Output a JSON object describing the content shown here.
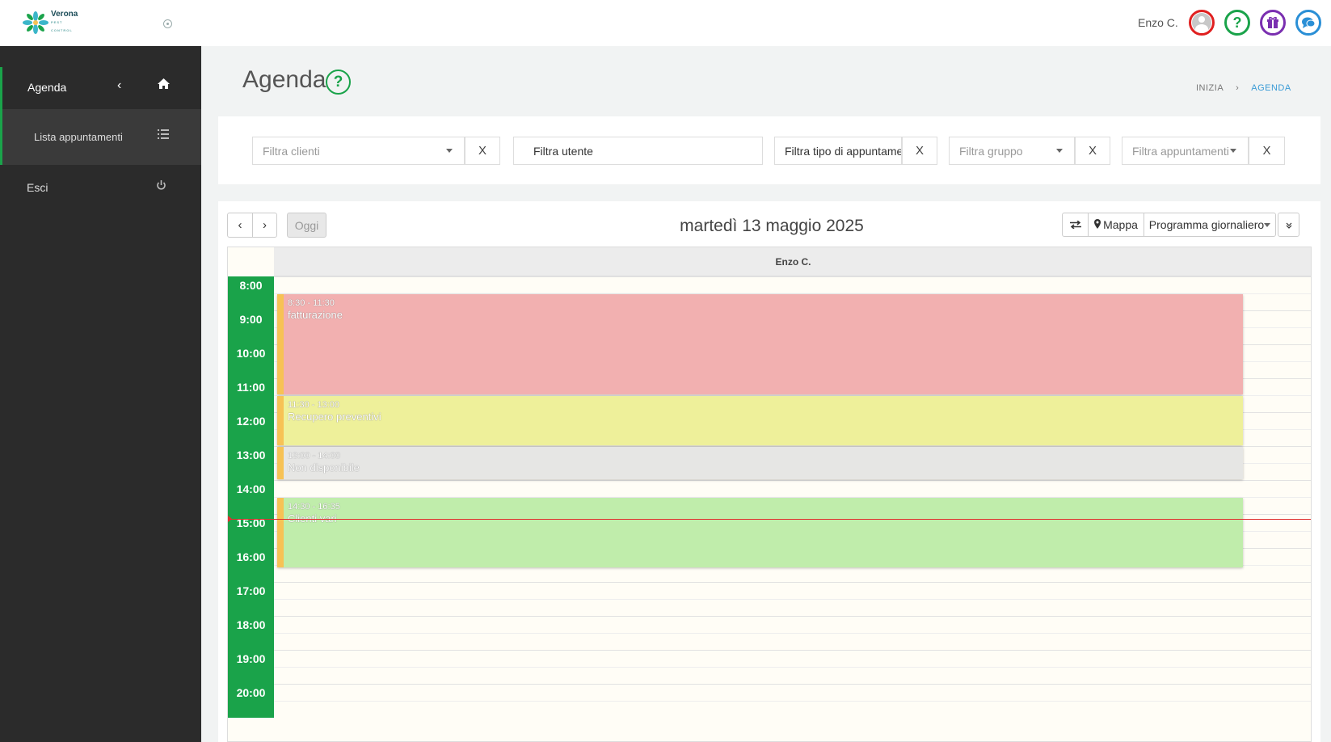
{
  "header": {
    "logo_name": "Verona",
    "logo_tagline": "PEST CONTROL",
    "user_name": "Enzo C.",
    "icons": [
      "user-avatar-icon",
      "help-icon",
      "gift-icon",
      "chat-icon"
    ]
  },
  "sidebar": {
    "items": [
      {
        "label": "Agenda",
        "icon": "home-icon"
      },
      {
        "label": "Lista appuntamenti",
        "icon": "list-icon"
      },
      {
        "label": "Esci",
        "icon": "power-icon"
      }
    ]
  },
  "page": {
    "title": "Agenda",
    "breadcrumb": {
      "home": "INIZIA",
      "current": "AGENDA"
    }
  },
  "filters": {
    "clienti_placeholder": "Filtra clienti",
    "utente_value": "Filtra utente",
    "tipo_value": "Filtra tipo di appuntamento",
    "gruppo_placeholder": "Filtra gruppo",
    "appuntamenti_placeholder": "Filtra appuntamenti",
    "clear_label": "X"
  },
  "calendar": {
    "today_label": "Oggi",
    "date_title": "martedì 13 maggio 2025",
    "map_label": "Mappa",
    "view_label": "Programma giornaliero",
    "resource": "Enzo C.",
    "hours": [
      "8:00",
      "9:00",
      "10:00",
      "11:00",
      "12:00",
      "13:00",
      "14:00",
      "15:00",
      "16:00",
      "17:00",
      "18:00",
      "19:00",
      "20:00"
    ],
    "events": [
      {
        "time": "8:30 - 11:30",
        "title": "fatturazione",
        "color": "#f2b0b0"
      },
      {
        "time": "11:30 - 13:00",
        "title": "Recupero preventivi",
        "color": "#eef09a"
      },
      {
        "time": "13:00 - 14:00",
        "title": "Non disponibile",
        "color": "#e6e6e4"
      },
      {
        "time": "14:30 - 16:35",
        "title": "Clienti vari",
        "color": "#c0edab"
      }
    ]
  },
  "colors": {
    "accent_green": "#1aa34a",
    "sidebar_bg": "#2b2b2b",
    "now_line": "#e03030",
    "event_border": "#f7c255"
  }
}
